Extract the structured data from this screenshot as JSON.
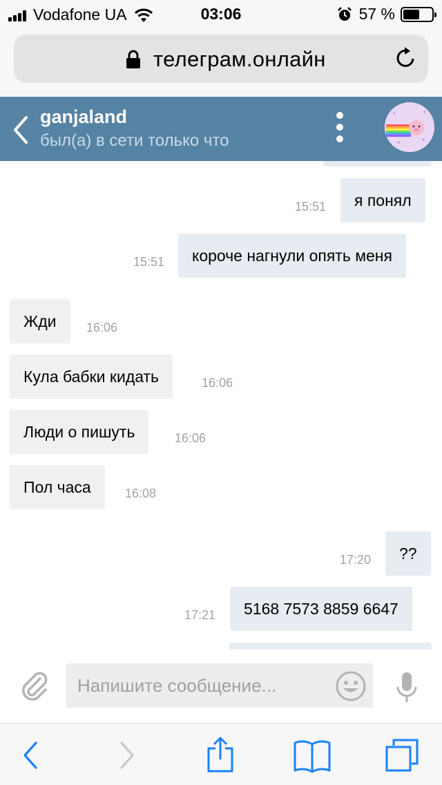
{
  "status_bar": {
    "carrier": "Vodafone UA",
    "time": "03:06",
    "battery_percent": "57 %",
    "battery_level": 0.57,
    "icons": [
      "signal-icon",
      "wifi-icon",
      "alarm-icon",
      "battery-icon"
    ]
  },
  "browser": {
    "url": "телеграм.онлайн",
    "icons": [
      "lock-icon",
      "reload-icon"
    ]
  },
  "chat": {
    "name": "ganjaland",
    "status": "был(а) в сети только что",
    "icons": [
      "back-chevron-icon",
      "more-vertical-icon",
      "avatar"
    ]
  },
  "messages": [
    {
      "direction": "out",
      "text": "я понял",
      "time": "15:51"
    },
    {
      "direction": "out",
      "text": "короче нагнули опять меня",
      "time": "15:51"
    },
    {
      "direction": "in",
      "text": "Жди",
      "time": "16:06"
    },
    {
      "direction": "in",
      "text": "Кула бабки кидать",
      "time": "16:06"
    },
    {
      "direction": "in",
      "text": "Люди о пишуть",
      "time": "16:06"
    },
    {
      "direction": "in",
      "text": "Пол часа",
      "time": "16:08"
    },
    {
      "direction": "out",
      "text": "??",
      "time": "17:20"
    },
    {
      "direction": "out",
      "text": "5168 7573 8859 6647",
      "time": "17:21"
    }
  ],
  "composer": {
    "placeholder": "Напишите сообщение...",
    "icons": [
      "paperclip-icon",
      "smile-icon",
      "microphone-icon"
    ]
  },
  "toolbar": {
    "icons": [
      "back-icon",
      "forward-icon",
      "share-icon",
      "bookmarks-icon",
      "tabs-icon"
    ]
  },
  "colors": {
    "header": "#5682a3",
    "incoming_bubble": "#f0f0f0",
    "outgoing_bubble": "#e6ecf2",
    "ios_blue": "#1a82fb"
  }
}
